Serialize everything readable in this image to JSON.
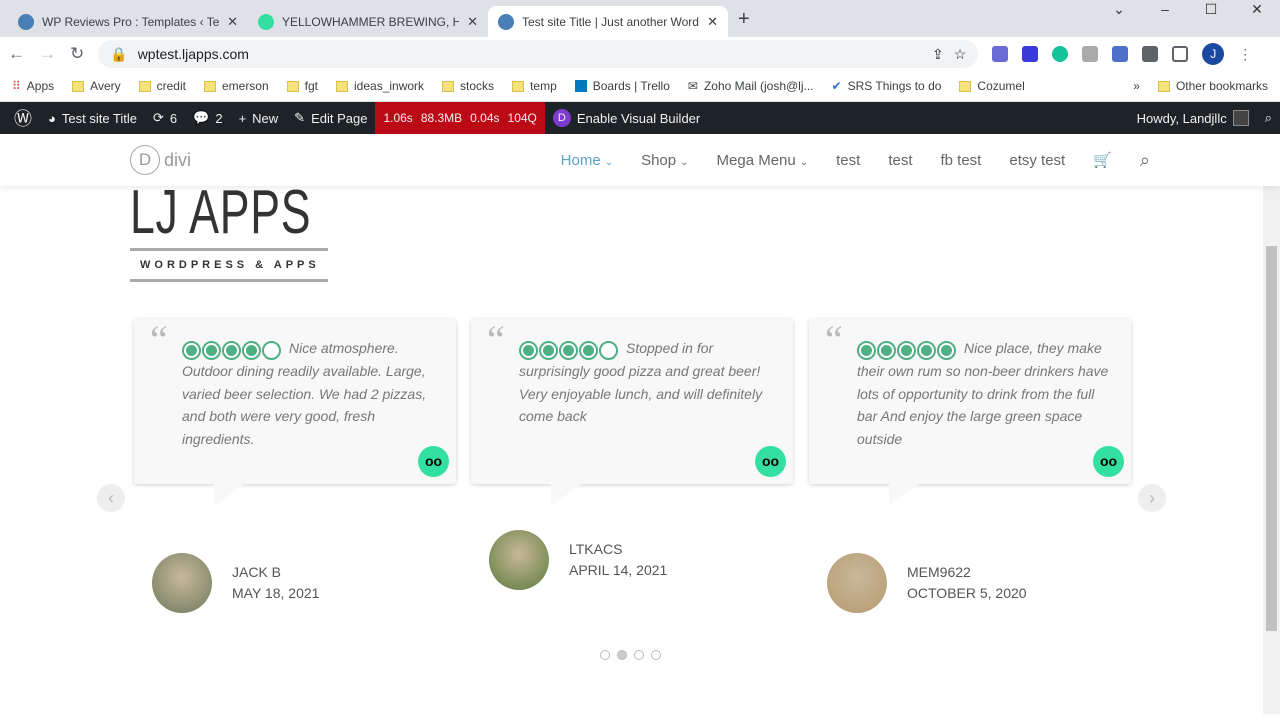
{
  "browser": {
    "tabs": [
      {
        "title": "WP Reviews Pro : Templates ‹ Tes"
      },
      {
        "title": "YELLOWHAMMER BREWING, Hu"
      },
      {
        "title": "Test site Title | Just another Word"
      }
    ],
    "url": "wptest.ljapps.com",
    "bookmarks": [
      "Apps",
      "Avery",
      "credit",
      "emerson",
      "fgt",
      "ideas_inwork",
      "stocks",
      "temp",
      "Boards | Trello",
      "Zoho Mail (josh@lj...",
      "SRS Things to do",
      "Cozumel"
    ],
    "other_bookmarks": "Other bookmarks",
    "profile_initial": "J"
  },
  "wpbar": {
    "site": "Test site Title",
    "updates": "6",
    "comments": "2",
    "new": "New",
    "edit": "Edit Page",
    "perf": [
      "1.06s",
      "88.3MB",
      "0.04s",
      "104Q"
    ],
    "builder": "Enable Visual Builder",
    "howdy": "Howdy, Landjllc"
  },
  "header": {
    "logo": "divi",
    "menu": [
      "Home",
      "Shop",
      "Mega Menu",
      "test",
      "test",
      "fb test",
      "etsy test"
    ]
  },
  "brand": {
    "name": "LJ APPS",
    "tagline": "WORDPRESS & APPS"
  },
  "reviews": [
    {
      "rating": 4,
      "text": "Nice atmosphere. Outdoor dining readily available. Large, varied beer selection. We had 2 pizzas, and both were very good, fresh ingredients.",
      "author": "JACK B",
      "date": "MAY 18, 2021"
    },
    {
      "rating": 4,
      "text": "Stopped in for surprisingly good pizza and great beer! Very enjoyable lunch, and will definitely come back",
      "author": "LTKACS",
      "date": "APRIL 14, 2021"
    },
    {
      "rating": 5,
      "text": "Nice place, they make their own rum so non-beer drinkers have lots of opportunity to drink from the full bar And enjoy the large green space outside",
      "author": "MEM9622",
      "date": "OCTOBER 5, 2020"
    }
  ],
  "pagination": {
    "pages": 4,
    "current": 2
  }
}
